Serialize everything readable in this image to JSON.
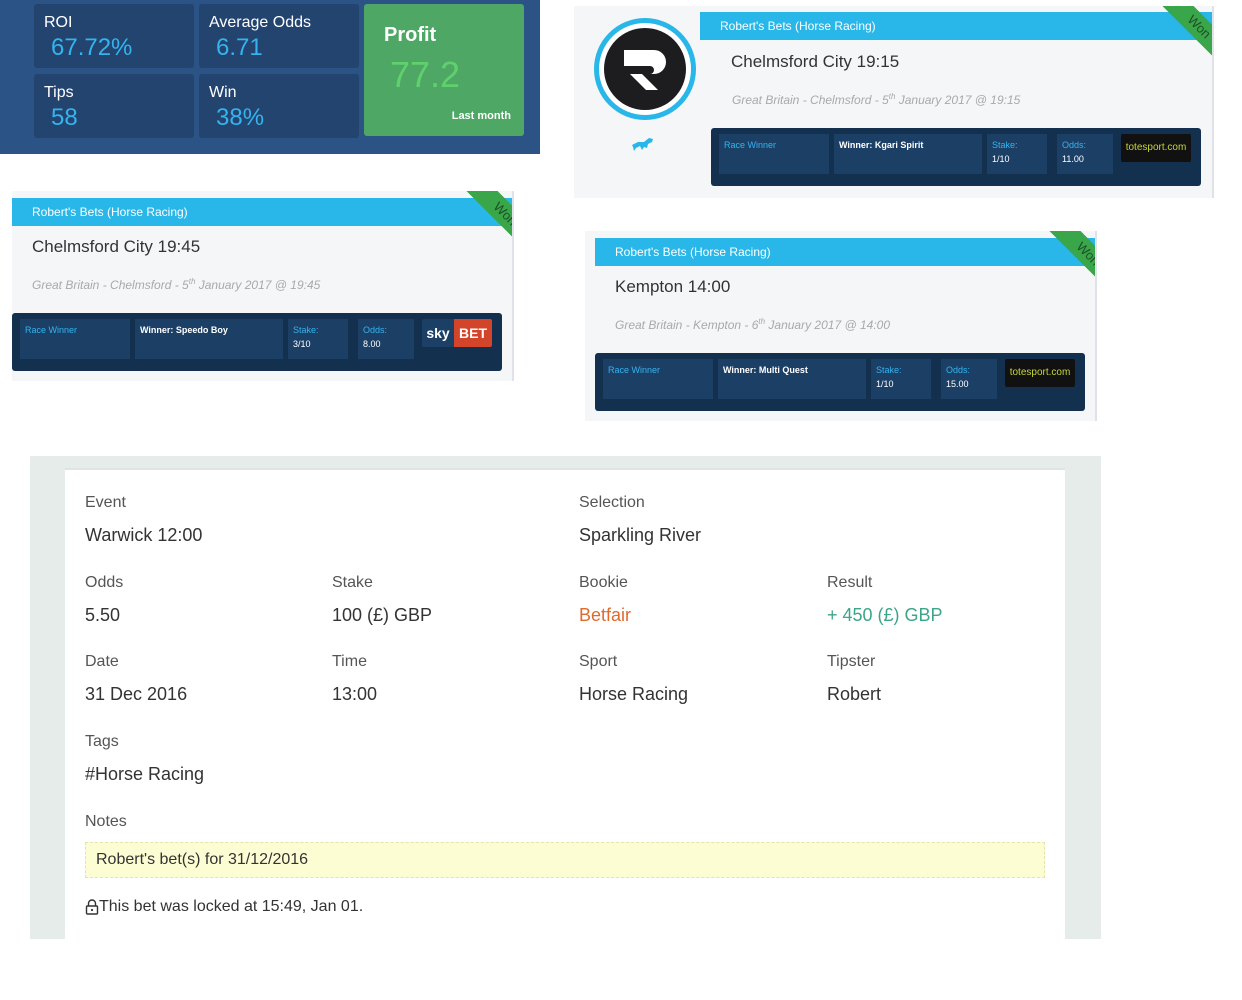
{
  "stats": {
    "roi": {
      "label": "ROI",
      "value": "67.72%"
    },
    "avg_odds": {
      "label": "Average Odds",
      "value": "6.71"
    },
    "tips": {
      "label": "Tips",
      "value": "58"
    },
    "win": {
      "label": "Win",
      "value": "38%"
    },
    "profit": {
      "label": "Profit",
      "value": "77.2",
      "sub": "Last month"
    }
  },
  "cards": [
    {
      "header": "Robert's Bets (Horse Racing)",
      "title": "Chelmsford City 19:15",
      "meta_a": "Great Britain - Chelmsford - 5",
      "meta_sup": "th",
      "meta_b": " January 2017 @ 19:15",
      "ribbon": "Won",
      "market": "Race Winner",
      "selection": "Winner: Kgari Spirit",
      "stake_label": "Stake:",
      "stake": "1/10",
      "odds_label": "Odds:",
      "odds": "11.00",
      "bookie": "totesport.com"
    },
    {
      "header": "Robert's Bets (Horse Racing)",
      "title": "Chelmsford City 19:45",
      "meta_a": "Great Britain - Chelmsford - 5",
      "meta_sup": "th",
      "meta_b": " January 2017 @ 19:45",
      "ribbon": "Won",
      "market": "Race Winner",
      "selection": "Winner: Speedo Boy",
      "stake_label": "Stake:",
      "stake": "3/10",
      "odds_label": "Odds:",
      "odds": "8.00",
      "bookie_a": "sky",
      "bookie_b": "BET"
    },
    {
      "header": "Robert's Bets (Horse Racing)",
      "title": "Kempton 14:00",
      "meta_a": "Great Britain - Kempton - 6",
      "meta_sup": "th",
      "meta_b": " January 2017 @ 14:00",
      "ribbon": "Won",
      "market": "Race Winner",
      "selection": "Winner: Multi Quest",
      "stake_label": "Stake:",
      "stake": "1/10",
      "odds_label": "Odds:",
      "odds": "15.00",
      "bookie": "totesport.com"
    }
  ],
  "detail": {
    "event_label": "Event",
    "event": "Warwick 12:00",
    "selection_label": "Selection",
    "selection": "Sparkling River",
    "odds_label": "Odds",
    "odds": "5.50",
    "stake_label": "Stake",
    "stake": "100 (£) GBP",
    "bookie_label": "Bookie",
    "bookie": "Betfair",
    "result_label": "Result",
    "result": "+ 450 (£) GBP",
    "date_label": "Date",
    "date": "31 Dec 2016",
    "time_label": "Time",
    "time": "13:00",
    "sport_label": "Sport",
    "sport": "Horse Racing",
    "tipster_label": "Tipster",
    "tipster": "Robert",
    "tags_label": "Tags",
    "tags": "#Horse Racing",
    "notes_label": "Notes",
    "notes": "Robert's bet(s) for 31/12/2016",
    "locked": "This bet was locked at 15:49, Jan 01."
  },
  "colors": {
    "stats_bg": "#2c5385",
    "accent_blue": "#29b6e8",
    "won_green": "#3aa64a",
    "bookie_orange": "#e06a2c",
    "result_green": "#3da58a"
  }
}
